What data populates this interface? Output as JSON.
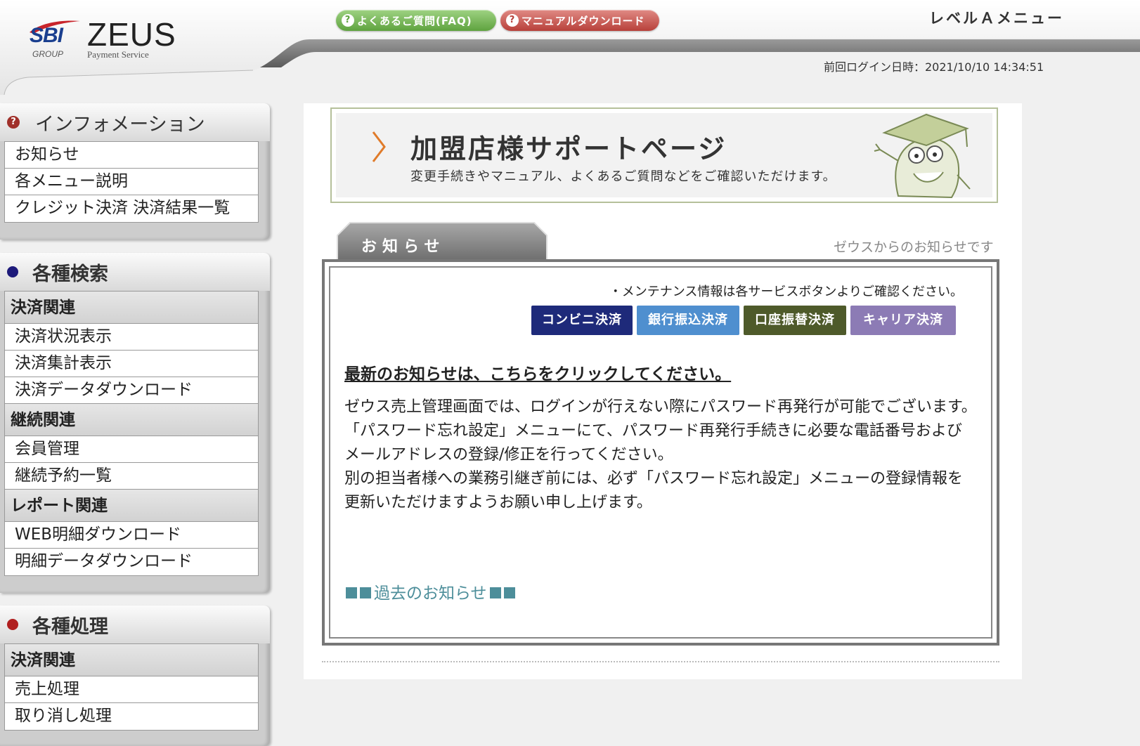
{
  "header": {
    "logo": {
      "brand": "SBI",
      "name": "ZEUS",
      "group": "GROUP",
      "tagline": "Payment Service"
    },
    "faq_button": "よくあるご質問(FAQ)",
    "manual_button": "マニュアルダウンロード",
    "level_menu": "レベルＡメニュー",
    "last_login": "前回ログイン日時：2021/10/10 14:34:51"
  },
  "sidebar": {
    "info": {
      "title": "インフォメーション",
      "items": [
        "お知らせ",
        "各メニュー説明",
        "クレジット決済 決済結果一覧"
      ]
    },
    "search": {
      "title": "各種検索",
      "bullet_color": "#1d1a7a",
      "groups": [
        {
          "category": "決済関連",
          "items": [
            "決済状況表示",
            "決済集計表示",
            "決済データダウンロード"
          ]
        },
        {
          "category": "継続関連",
          "items": [
            "会員管理",
            "継続予約一覧"
          ]
        },
        {
          "category": "レポート関連",
          "items": [
            "WEB明細ダウンロード",
            "明細データダウンロード"
          ]
        }
      ]
    },
    "process": {
      "title": "各種処理",
      "bullet_color": "#b01f1f",
      "groups": [
        {
          "category": "決済関連",
          "items": [
            "売上処理",
            "取り消し処理"
          ]
        }
      ]
    }
  },
  "banner": {
    "title": "加盟店様サポートページ",
    "subtitle": "変更手続きやマニュアル、よくあるご質問などをご確認いただけます。"
  },
  "notices": {
    "tab_label": "お知らせ",
    "subtitle": "ゼウスからのお知らせです",
    "maintenance_note": "・メンテナンス情報は各サービスボタンよりご確認ください。",
    "service_buttons": [
      {
        "label": "コンビニ決済",
        "color": "#1e2a7a"
      },
      {
        "label": "銀行振込決済",
        "color": "#4f8fcf"
      },
      {
        "label": "口座振替決済",
        "color": "#4e5a2a"
      },
      {
        "label": "キャリア決済",
        "color": "#8c7bb5"
      }
    ],
    "latest_link": "最新のお知らせは、こちらをクリックしてください。",
    "body": [
      "ゼウス売上管理画面では、ログインが行えない際にパスワード再発行が可能でございます。",
      "「パスワード忘れ設定」メニューにて、パスワード再発行手続きに必要な電話番号およびメールアドレスの登録/修正を行ってください。",
      "別の担当者様への業務引継ぎ前には、必ず「パスワード忘れ設定」メニューの登録情報を更新いただけますようお願い申し上げます。"
    ],
    "past_link": "過去のお知らせ"
  }
}
